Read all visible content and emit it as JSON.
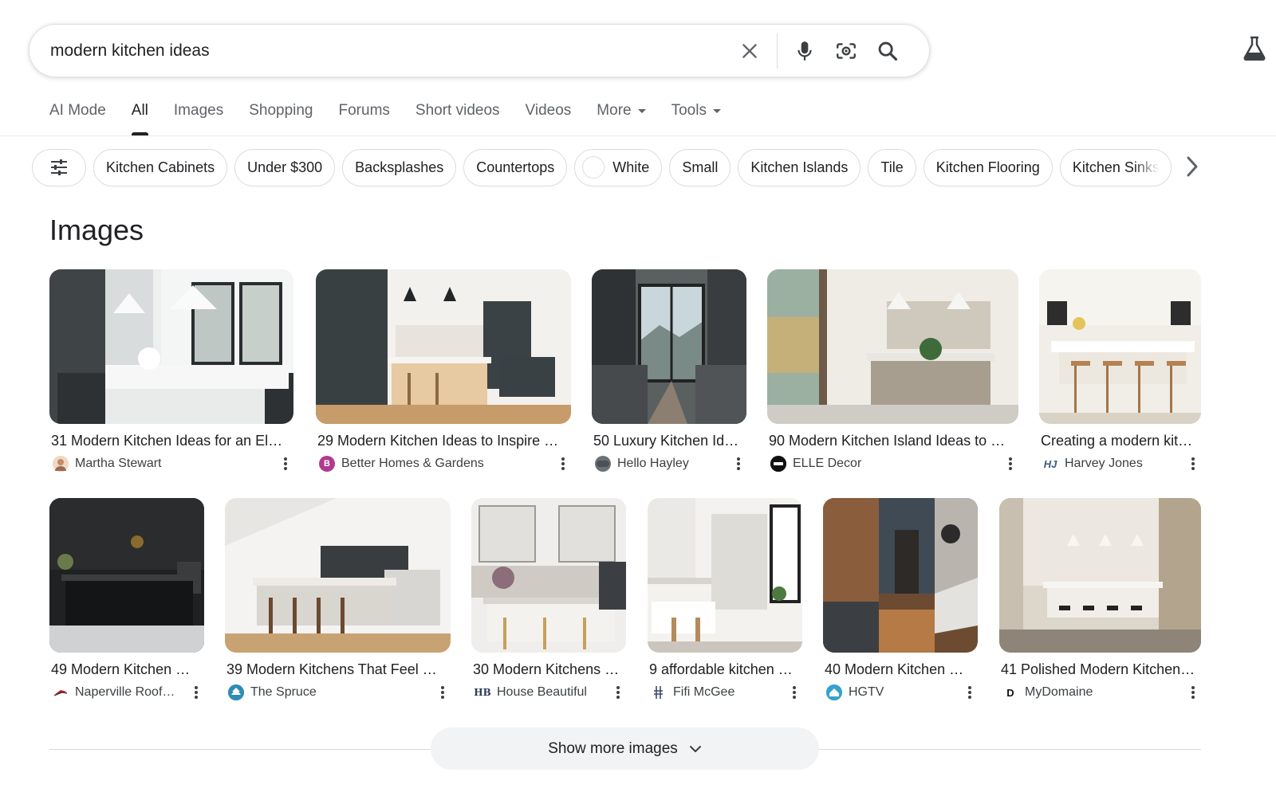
{
  "search": {
    "query": "modern kitchen ideas"
  },
  "tabs": [
    {
      "label": "AI Mode"
    },
    {
      "label": "All",
      "active": true
    },
    {
      "label": "Images"
    },
    {
      "label": "Shopping"
    },
    {
      "label": "Forums"
    },
    {
      "label": "Short videos"
    },
    {
      "label": "Videos"
    },
    {
      "label": "More",
      "dropdown": true
    },
    {
      "label": "Tools",
      "dropdown": true
    }
  ],
  "chips": [
    {
      "label": "Kitchen Cabinets"
    },
    {
      "label": "Under $300"
    },
    {
      "label": "Backsplashes"
    },
    {
      "label": "Countertops"
    },
    {
      "label": "White",
      "swatch": "#ffffff"
    },
    {
      "label": "Small"
    },
    {
      "label": "Kitchen Islands"
    },
    {
      "label": "Tile"
    },
    {
      "label": "Kitchen Flooring"
    },
    {
      "label": "Kitchen Sinks"
    }
  ],
  "section_title": "Images",
  "results": [
    {
      "title": "31 Modern Kitchen Ideas for an El…",
      "source": "Martha Stewart",
      "icon": "martha-stewart-favicon",
      "favicon_bg": "#e8c4a8",
      "favicon_text": ""
    },
    {
      "title": "29 Modern Kitchen Ideas to Inspire …",
      "source": "Better Homes & Gardens",
      "icon": "bhg-favicon",
      "favicon_bg": "#b03a8f",
      "favicon_text": "B"
    },
    {
      "title": "50 Luxury Kitchen Id…",
      "source": "Hello Hayley",
      "icon": "hello-hayley-favicon",
      "favicon_bg": "#6b7178",
      "favicon_text": ""
    },
    {
      "title": "90 Modern Kitchen Island Ideas to …",
      "source": "ELLE Decor",
      "icon": "elle-decor-favicon",
      "favicon_bg": "#111111",
      "favicon_text": ""
    },
    {
      "title": "Creating a modern kit…",
      "source": "Harvey Jones",
      "icon": "harvey-jones-favicon",
      "favicon_bg": "#ffffff",
      "favicon_text": "HJ"
    },
    {
      "title": "49 Modern Kitchen …",
      "source": "Naperville Roof…",
      "icon": "naperville-favicon",
      "favicon_bg": "#ffffff",
      "favicon_text": ""
    },
    {
      "title": "39 Modern Kitchens That Feel …",
      "source": "The Spruce",
      "icon": "spruce-favicon",
      "favicon_bg": "#3a8fb7",
      "favicon_text": ""
    },
    {
      "title": "30 Modern Kitchens …",
      "source": "House Beautiful",
      "icon": "house-beautiful-favicon",
      "favicon_bg": "#ffffff",
      "favicon_text": "HB"
    },
    {
      "title": "9 affordable kitchen …",
      "source": "Fifi McGee",
      "icon": "fifi-mcgee-favicon",
      "favicon_bg": "#ffffff",
      "favicon_text": ""
    },
    {
      "title": "40 Modern Kitchen …",
      "source": "HGTV",
      "icon": "hgtv-favicon",
      "favicon_bg": "#3aa2c9",
      "favicon_text": ""
    },
    {
      "title": "41 Polished Modern Kitchen…",
      "source": "MyDomaine",
      "icon": "mydomaine-favicon",
      "favicon_bg": "#ffffff",
      "favicon_text": "D"
    }
  ],
  "show_more": {
    "label": "Show more images"
  }
}
